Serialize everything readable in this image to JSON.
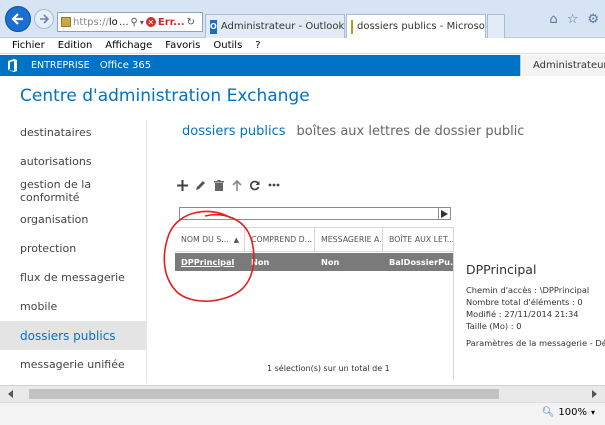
{
  "browser": {
    "address_text": "https://",
    "address_host": "local",
    "address_ellipsis": "...",
    "cert_error": "Err...",
    "tabs": [
      {
        "label": "Administrateur - Outlook Web ..."
      },
      {
        "label": "dossiers publics - Microsoft..."
      }
    ],
    "menu": [
      "Fichier",
      "Edition",
      "Affichage",
      "Favoris",
      "Outils",
      "?"
    ],
    "zoom": "100%"
  },
  "o365": {
    "enterprise_label": "ENTREPRISE",
    "brand": "Office 365",
    "user_menu": "Administrateur"
  },
  "app": {
    "title": "Centre d'administration Exchange"
  },
  "sidebar": {
    "items": [
      {
        "label": "destinataires"
      },
      {
        "label": "autorisations"
      },
      {
        "label": "gestion de la conformité"
      },
      {
        "label": "organisation"
      },
      {
        "label": "protection"
      },
      {
        "label": "flux de messagerie"
      },
      {
        "label": "mobile"
      },
      {
        "label": "dossiers publics"
      },
      {
        "label": "messagerie unifiée"
      }
    ],
    "active_index": 7
  },
  "page": {
    "tabs": [
      {
        "label": "dossiers publics",
        "active": true
      },
      {
        "label": "boîtes aux lettres de dossier public",
        "active": false
      }
    ],
    "toolbar_icons": [
      "add-icon",
      "edit-icon",
      "delete-icon",
      "move-up-icon",
      "refresh-icon",
      "more-icon"
    ]
  },
  "grid": {
    "columns": [
      "NOM DU S...",
      "COMPREND D...",
      "MESSAGERIE A...",
      "BOÎTE AUX LET..."
    ],
    "rows": [
      [
        "DPPrincipal",
        "Non",
        "Non",
        "BalDossierPu..."
      ]
    ],
    "footer": "1 sélection(s) sur un total de 1"
  },
  "detail": {
    "title": "DPPrincipal",
    "lines": [
      "Chemin d'accès : \\DPPrincipal",
      "Nombre total d'éléments : 0",
      "Modifié : 27/11/2014 21:34",
      "Taille (Mo) : 0"
    ],
    "settings_label": "Paramètres de la messagerie - Désa"
  },
  "colors": {
    "accent": "#0072c6",
    "selected_row": "#7a7a7a",
    "annotation": "#e0201a"
  }
}
